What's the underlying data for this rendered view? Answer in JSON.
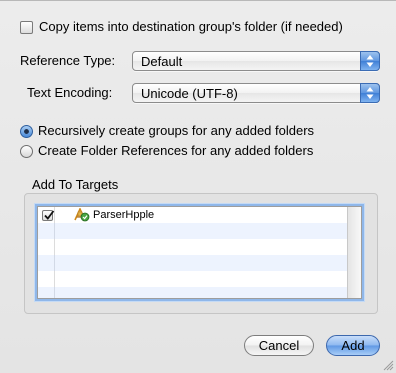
{
  "copy_option": {
    "label": "Copy items into destination group's folder (if needed)",
    "checked": false
  },
  "reference_type": {
    "label": "Reference Type:",
    "selected": "Default"
  },
  "text_encoding": {
    "label": "Text Encoding:",
    "selected": "Unicode (UTF-8)"
  },
  "folders": {
    "options": [
      {
        "label": "Recursively create groups for any added folders",
        "selected": true
      },
      {
        "label": "Create Folder References for any added folders",
        "selected": false
      }
    ]
  },
  "targets": {
    "label": "Add To Targets",
    "items": [
      {
        "name": "ParserHpple",
        "checked": true,
        "icon": "target-icon"
      }
    ]
  },
  "buttons": {
    "cancel": "Cancel",
    "add": "Add"
  },
  "colors": {
    "accent": "#5f98e4",
    "table_alt_row": "#edf3fe"
  }
}
